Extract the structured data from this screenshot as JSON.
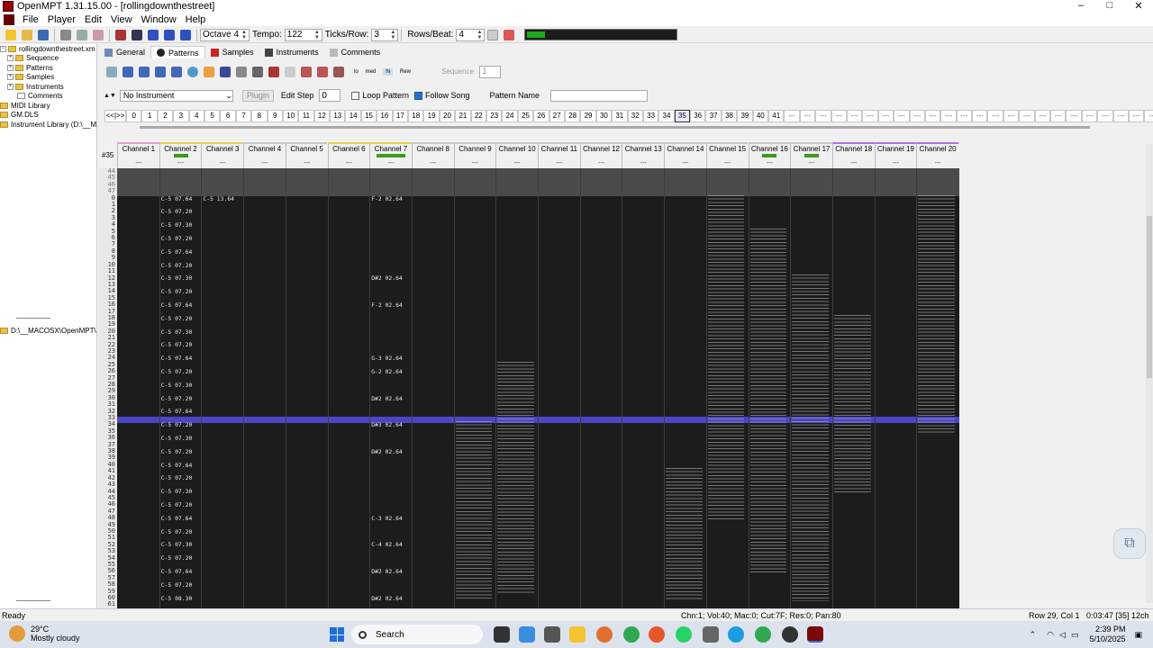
{
  "window": {
    "title": "OpenMPT 1.31.15.00 - [rollingdownthestreet]",
    "controls": [
      "–",
      "□",
      "✕"
    ]
  },
  "menu": [
    "File",
    "Player",
    "Edit",
    "View",
    "Window",
    "Help"
  ],
  "toolbar": {
    "octave": "Octave 4",
    "tempo_label": "Tempo:",
    "tempo_value": "122",
    "ticks_label": "Ticks/Row:",
    "ticks_value": "3",
    "rows_label": "Rows/Beat:",
    "rows_value": "4"
  },
  "tree": {
    "items": [
      "rollingdownthestreet.xm",
      "Sequence",
      "Patterns",
      "Samples",
      "Instruments",
      "Comments",
      "MIDI Library",
      "GM.DLS",
      "Instrument Library (D:\\__M..."
    ],
    "path": "D:\\__MACOSX\\OpenMPT\\"
  },
  "tabs": [
    "General",
    "Patterns",
    "Samples",
    "Instruments",
    "Comments"
  ],
  "pattern_toolbar": {
    "sequence_label": "Sequence",
    "sequence_value": "1",
    "instrument": "No Instrument",
    "plugin": "Plugin",
    "edit_step_label": "Edit Step",
    "edit_step_value": "0",
    "loop_pattern": "Loop Pattern",
    "follow_song": "Follow Song",
    "pattern_name_label": "Pattern Name",
    "lo": "lo",
    "med": "med",
    "hi": "hi",
    "rew": "Rew"
  },
  "orders": {
    "nav": "<<|>>",
    "items": [
      "0",
      "1",
      "2",
      "3",
      "4",
      "5",
      "6",
      "7",
      "8",
      "9",
      "10",
      "11",
      "12",
      "13",
      "14",
      "15",
      "16",
      "17",
      "18",
      "19",
      "20",
      "21",
      "22",
      "23",
      "24",
      "25",
      "26",
      "27",
      "28",
      "29",
      "30",
      "31",
      "32",
      "33",
      "34",
      "35",
      "36",
      "37",
      "38",
      "39",
      "40",
      "41",
      "---",
      "---",
      "---",
      "---",
      "---",
      "---",
      "---",
      "---",
      "---",
      "---",
      "---",
      "---",
      "---",
      "---",
      "---",
      "---",
      "---",
      "---",
      "---",
      "---",
      "---",
      "---",
      "---",
      "---"
    ],
    "selected": "35"
  },
  "pattern": {
    "number": "#35",
    "channels": [
      "Channel 1",
      "Channel 2",
      "Channel 3",
      "Channel 4",
      "Channel 5",
      "Channel 6",
      "Channel 7",
      "Channel 8",
      "Channel 9",
      "Channel 10",
      "Channel 11",
      "Channel 12",
      "Channel 13",
      "Channel 14",
      "Channel 15",
      "Channel 16",
      "Channel 17",
      "Channel 18",
      "Channel 19",
      "Channel 20"
    ],
    "channel_placeholder": "---",
    "prev_rows": [
      "44",
      "45",
      "46",
      "47"
    ],
    "rows": [
      "0",
      "1",
      "2",
      "3",
      "4",
      "5",
      "6",
      "7",
      "8",
      "9",
      "10",
      "11",
      "12",
      "13",
      "14",
      "15",
      "16",
      "17",
      "18",
      "19",
      "20",
      "21",
      "22",
      "23",
      "24",
      "25",
      "26",
      "27",
      "28",
      "29",
      "30",
      "31",
      "32",
      "33",
      "34",
      "35",
      "36",
      "37",
      "38",
      "39",
      "40",
      "41",
      "42",
      "43",
      "44",
      "45",
      "46",
      "47",
      "48",
      "49",
      "50",
      "51",
      "52",
      "53",
      "54",
      "55",
      "56",
      "57",
      "58",
      "59",
      "60",
      "61"
    ],
    "ch2_notes": [
      {
        "row": 0,
        "text": "C-5 07.64"
      },
      {
        "row": 2,
        "text": "C-5 07.20"
      },
      {
        "row": 4,
        "text": "C-5 07.30"
      },
      {
        "row": 6,
        "text": "C-5 07.20"
      },
      {
        "row": 8,
        "text": "C-5 07.64"
      },
      {
        "row": 10,
        "text": "C-5 07.20"
      },
      {
        "row": 12,
        "text": "C-5 07.30"
      },
      {
        "row": 14,
        "text": "C-5 07.20"
      },
      {
        "row": 16,
        "text": "C-5 07.64"
      },
      {
        "row": 18,
        "text": "C-5 07.20"
      },
      {
        "row": 20,
        "text": "C-5 07.30"
      },
      {
        "row": 22,
        "text": "C-5 07.20"
      },
      {
        "row": 24,
        "text": "C-5 07.64"
      },
      {
        "row": 26,
        "text": "C-5 07.20"
      },
      {
        "row": 28,
        "text": "C-5 07.30"
      },
      {
        "row": 30,
        "text": "C-5 07.20"
      },
      {
        "row": 32,
        "text": "C-5 07.64"
      },
      {
        "row": 34,
        "text": "C-5 07.20"
      },
      {
        "row": 36,
        "text": "C-5 07.30"
      },
      {
        "row": 38,
        "text": "C-5 07.20"
      },
      {
        "row": 40,
        "text": "C-5 07.64"
      },
      {
        "row": 42,
        "text": "C-5 07.20"
      },
      {
        "row": 44,
        "text": "C-5 07.30"
      },
      {
        "row": 46,
        "text": "C-5 07.20"
      },
      {
        "row": 48,
        "text": "C-5 07.64"
      },
      {
        "row": 50,
        "text": "C-5 07.20"
      },
      {
        "row": 52,
        "text": "C-5 07.30"
      },
      {
        "row": 54,
        "text": "C-5 07.20"
      },
      {
        "row": 56,
        "text": "C-5 07.64"
      },
      {
        "row": 58,
        "text": "C-5 07.20"
      },
      {
        "row": 60,
        "text": "C-5 08.30"
      }
    ],
    "ch7_notes": [
      {
        "row": 0,
        "text": "F-2 02.64"
      },
      {
        "row": 12,
        "text": "D#2 02.64"
      },
      {
        "row": 16,
        "text": "F-2 02.64"
      },
      {
        "row": 24,
        "text": "G-3 02.64"
      },
      {
        "row": 26,
        "text": "G-2 02.64"
      },
      {
        "row": 30,
        "text": "D#2 02.64"
      },
      {
        "row": 34,
        "text": "D#3 02.64"
      },
      {
        "row": 38,
        "text": "D#2 02.64"
      },
      {
        "row": 48,
        "text": "C-3 02.64"
      },
      {
        "row": 52,
        "text": "C-4 02.64"
      },
      {
        "row": 56,
        "text": "D#2 02.64"
      },
      {
        "row": 60,
        "text": "D#2 02.64"
      }
    ],
    "ch3_note": "C-5 13.64"
  },
  "status": {
    "left": "Ready",
    "middle": "Chn:1; Vol:40; Mac:0; Cut:7F; Res:0; Pan:80",
    "row": "Row 29, Col 1",
    "time": "0:03:47  [35] 12ch"
  },
  "taskbar": {
    "temp": "29°C",
    "weather": "Mostly cloudy",
    "search": "Search",
    "clock_time": "2:39 PM",
    "clock_date": "5/10/2025"
  },
  "colors": {
    "play_row": "#4a46c6",
    "volume_text": "#4fd34f",
    "pattern_bg": "#1c1c1c"
  }
}
